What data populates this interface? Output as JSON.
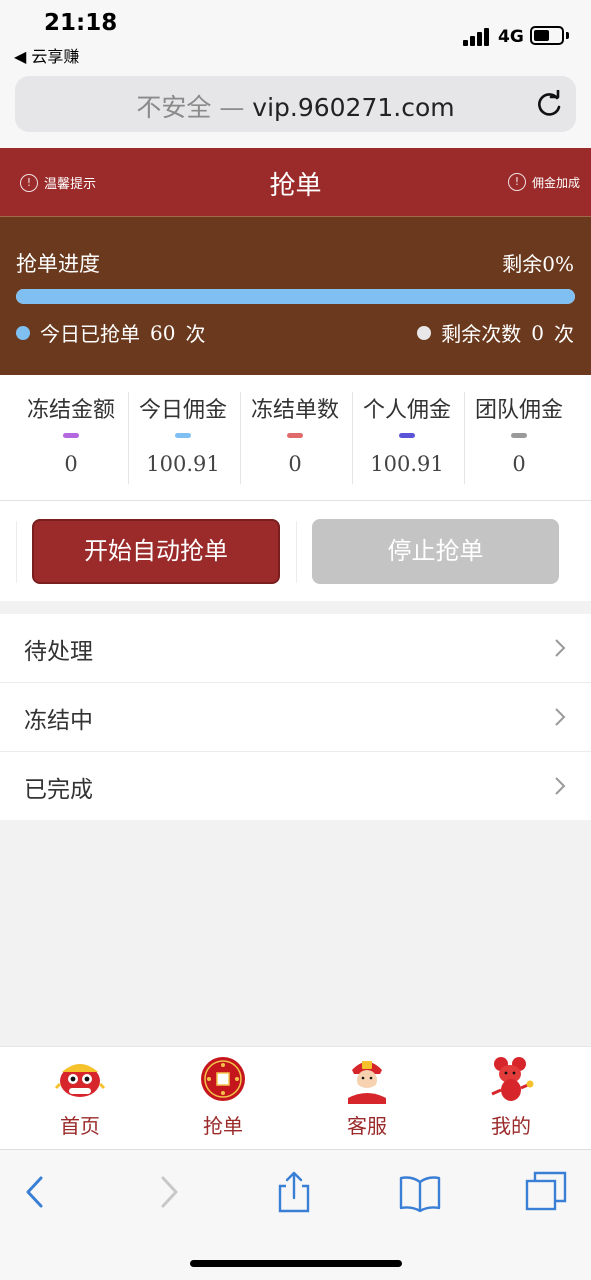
{
  "status_bar": {
    "time": "21:18",
    "back_app": "◀ 云享赚",
    "network": "4G",
    "battery_level": 0.55
  },
  "browser": {
    "insecure_label": "不安全 —",
    "domain": "vip.960271.com"
  },
  "header": {
    "hint_label": "温馨提示",
    "title": "抢单",
    "bonus_label": "佣金加成",
    "accent": "#9b2a2a"
  },
  "progress": {
    "title": "抢单进度",
    "remain_text": "剩余0%",
    "fill_fraction": 1.0,
    "today_prefix": "今日已抢单",
    "today_count": "60",
    "today_suffix": "次",
    "remain_prefix": "剩余次数",
    "remain_count": "0",
    "remain_suffix": "次",
    "bg": "#6b3a1e",
    "bar_color": "#7fbff2"
  },
  "stats": [
    {
      "label": "冻结金额",
      "value": "0",
      "color": "#b368e0"
    },
    {
      "label": "今日佣金",
      "value": "100.91",
      "color": "#7fbff2"
    },
    {
      "label": "冻结单数",
      "value": "0",
      "color": "#e06a6a"
    },
    {
      "label": "个人佣金",
      "value": "100.91",
      "color": "#5a55d8"
    },
    {
      "label": "团队佣金",
      "value": "0",
      "color": "#9a9a9a"
    }
  ],
  "actions": {
    "start_label": "开始自动抢单",
    "stop_label": "停止抢单"
  },
  "orders": [
    {
      "label": "待处理"
    },
    {
      "label": "冻结中"
    },
    {
      "label": "已完成"
    }
  ],
  "tabs": [
    {
      "label": "首页",
      "icon": "lion-dance-icon"
    },
    {
      "label": "抢单",
      "icon": "lucky-coin-icon"
    },
    {
      "label": "客服",
      "icon": "fortune-god-icon"
    },
    {
      "label": "我的",
      "icon": "mouse-mascot-icon"
    }
  ],
  "toolbar": {
    "icons": [
      "back-arrow-icon",
      "forward-arrow-icon",
      "share-icon",
      "bookmarks-icon",
      "tabs-icon"
    ]
  }
}
